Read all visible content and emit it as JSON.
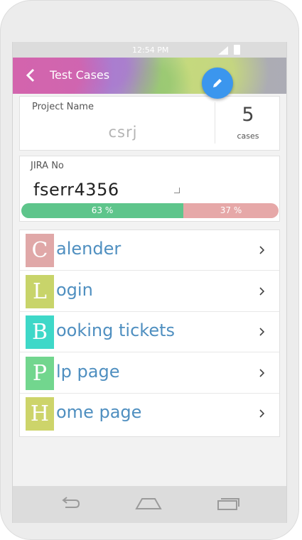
{
  "status_bar": {
    "time": "12:54 PM"
  },
  "app_bar": {
    "title": "Test Cases"
  },
  "project": {
    "label": "Project Name",
    "value": "csrj",
    "count": "5",
    "count_label": "cases"
  },
  "jira": {
    "label": "JIRA No",
    "value": "fserr4356",
    "pass_label": "63 %",
    "fail_label": "37 %",
    "pass_fraction": 0.63,
    "pass_color": "#5ec58b",
    "fail_color": "#e6a8a8"
  },
  "test_cases": [
    {
      "letter": "C",
      "rest": "alender",
      "color": "#e0a8a8"
    },
    {
      "letter": "L",
      "rest": "ogin",
      "color": "#c8d46a"
    },
    {
      "letter": "B",
      "rest": "ooking tickets",
      "color": "#3ed8c8"
    },
    {
      "letter": "P",
      "rest": "lp page",
      "color": "#72d68e"
    },
    {
      "letter": "H",
      "rest": "ome page",
      "color": "#cdd46a"
    }
  ],
  "icons": {
    "back": "arrow-left-icon",
    "edit": "pencil-icon",
    "chevron": "chevron-right-icon",
    "nav": [
      "back-icon",
      "home-icon",
      "recents-icon"
    ]
  }
}
